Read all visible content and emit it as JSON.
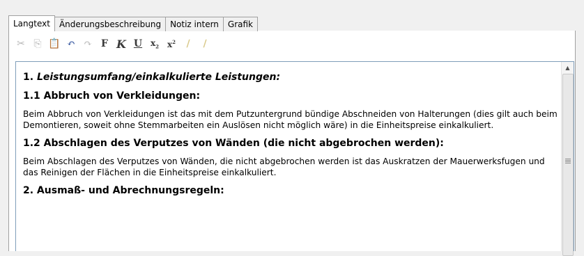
{
  "tabs": [
    {
      "label": "Langtext",
      "active": true
    },
    {
      "label": "Änderungsbeschreibung",
      "active": false
    },
    {
      "label": "Notiz intern",
      "active": false
    },
    {
      "label": "Grafik",
      "active": false
    }
  ],
  "toolbar": {
    "cut_icon": "✂",
    "copy_icon": "⎘",
    "paste_icon": "📋",
    "undo_icon": "↶",
    "redo_icon": "↷",
    "bold": "F",
    "italic": "K",
    "underline": "U",
    "subscript_base": "x",
    "subscript_mark": "2",
    "superscript_base": "x",
    "superscript_mark": "2",
    "highlight1_icon": "∕",
    "highlight2_icon": "∕"
  },
  "document": {
    "h1_number": "1. ",
    "h1_title": "Leistungsumfang/einkalkulierte Leistungen:",
    "s1_heading": "1.1 Abbruch von Verkleidungen:",
    "s1_text": "Beim Abbruch von Verkleidungen ist das mit dem Putzuntergrund bündige Abschneiden von Halterungen (dies gilt auch beim Demontieren, soweit ohne Stemmarbeiten ein Auslösen nicht möglich wäre) in die Einheitspreise einkalkuliert.",
    "s2_heading": "1.2 Abschlagen des Verputzes von Wänden (die nicht abgebrochen werden):",
    "s2_text": "Beim Abschlagen des Verputzes von Wänden, die nicht abgebrochen werden ist das Auskratzen der Mauerwerksfugen und das Reinigen der Flächen in die Einheitspreise einkalkuliert.",
    "h2_heading": "2. Ausmaß- und Abrechnungsregeln:"
  },
  "scrollbar": {
    "up_icon": "▲"
  }
}
